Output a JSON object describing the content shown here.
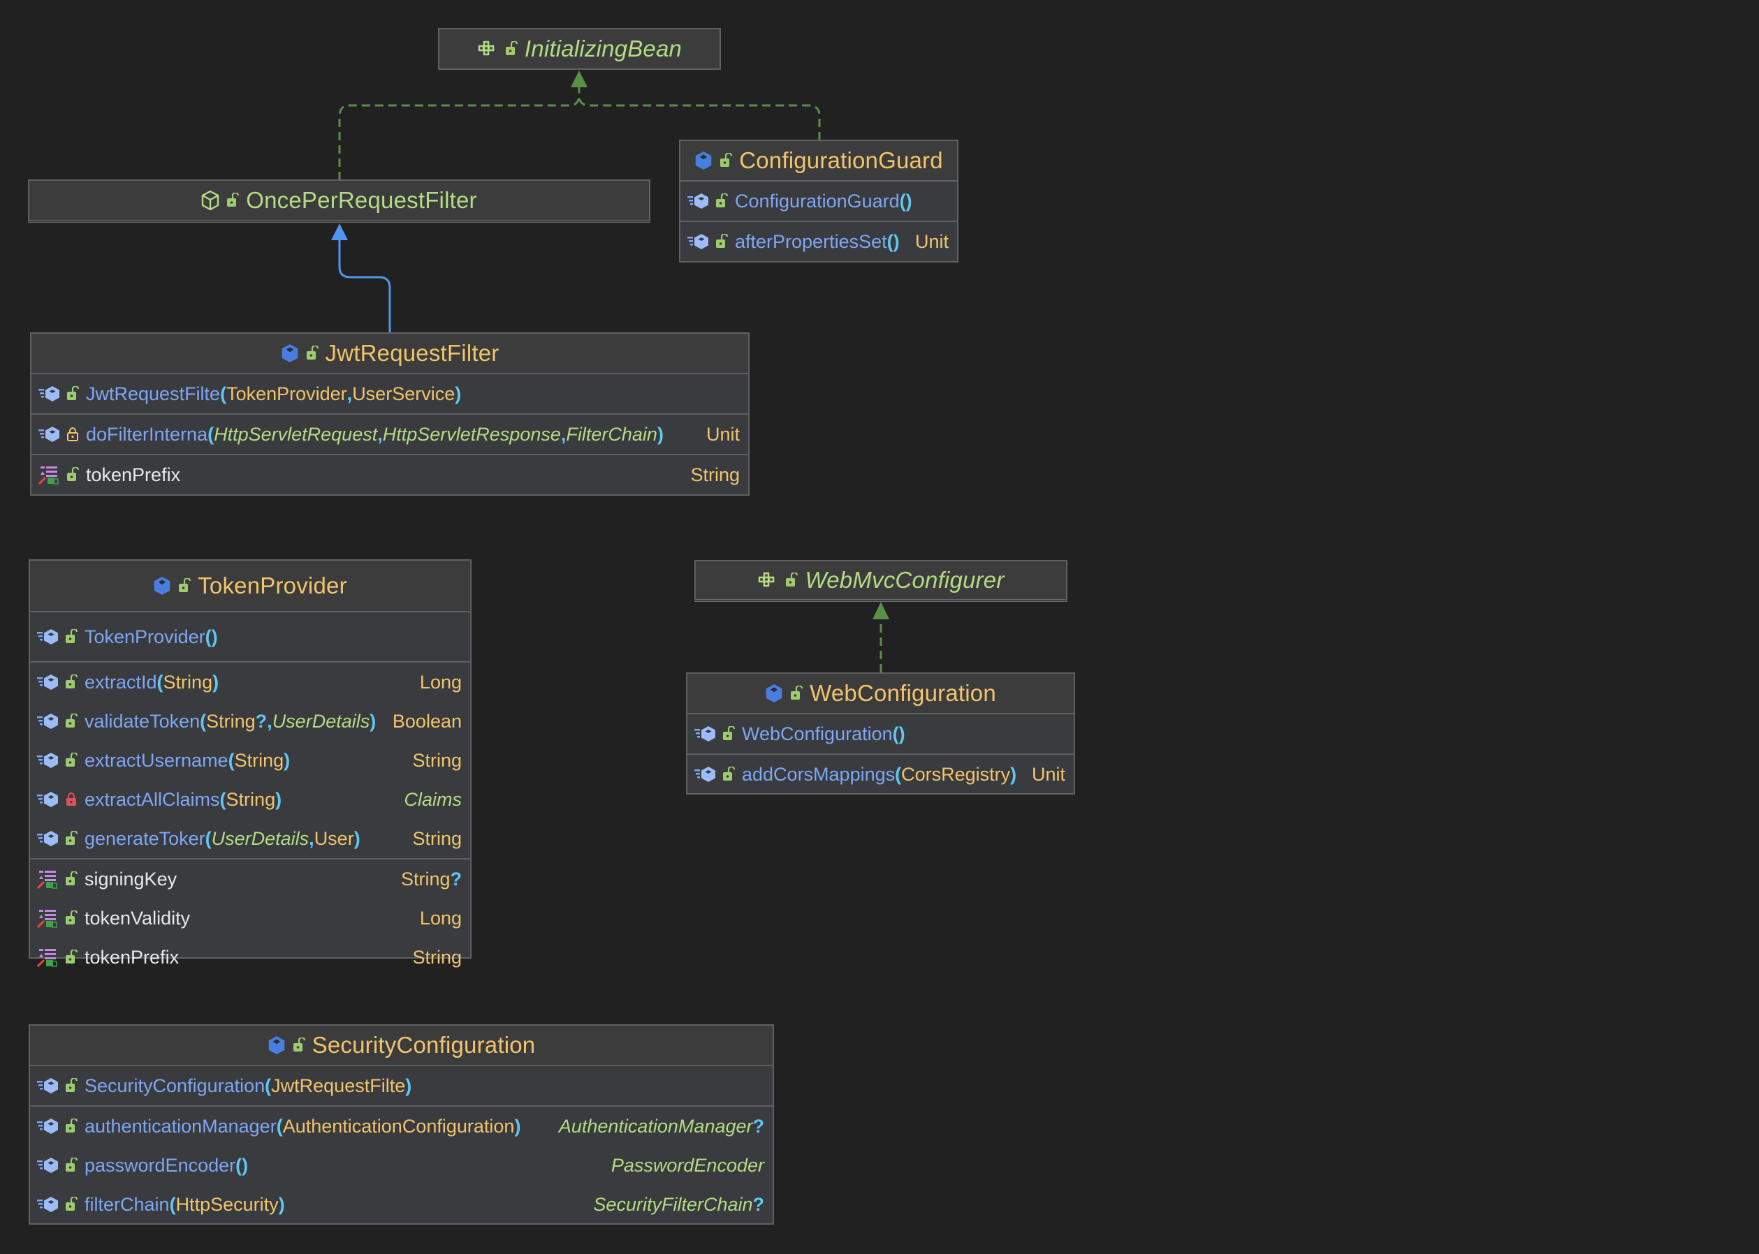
{
  "diagram": {
    "nodes": [
      {
        "id": "InitializingBean",
        "kind": "interface",
        "title": "InitializingBean",
        "members": []
      },
      {
        "id": "OncePerRequestFilter",
        "kind": "abstract-library-class",
        "title": "OncePerRequestFilter",
        "members": []
      },
      {
        "id": "ConfigurationGuard",
        "kind": "class",
        "title": "ConfigurationGuard",
        "constructors": [
          {
            "name": "ConfigurationGuard",
            "params": [],
            "visibility": "public"
          }
        ],
        "methods": [
          {
            "name": "afterPropertiesSet",
            "params": [],
            "returns": "Unit",
            "visibility": "public"
          }
        ]
      },
      {
        "id": "JwtRequestFilter",
        "kind": "class",
        "title": "JwtRequestFilter",
        "constructors": [
          {
            "name": "JwtRequestFilte",
            "params": [
              {
                "t": "TokenProvider"
              },
              {
                "t": "UserService"
              }
            ],
            "visibility": "public"
          }
        ],
        "methods": [
          {
            "name": "doFilterInterna",
            "params": [
              {
                "t": "HttpServletRequest",
                "platform": true
              },
              {
                "t": "HttpServletResponse",
                "platform": true
              },
              {
                "t": "FilterChain",
                "platform": true
              }
            ],
            "returns": "Unit",
            "visibility": "protected"
          }
        ],
        "fields": [
          {
            "name": "tokenPrefix",
            "type": "String",
            "visibility": "public"
          }
        ]
      },
      {
        "id": "TokenProvider",
        "kind": "class",
        "title": "TokenProvider",
        "constructors": [
          {
            "name": "TokenProvider",
            "params": [],
            "visibility": "public"
          }
        ],
        "methods": [
          {
            "name": "extractId",
            "params": [
              {
                "t": "String"
              }
            ],
            "returns": "Long",
            "visibility": "public"
          },
          {
            "name": "validateToken",
            "params": [
              {
                "t": "String",
                "nullable": true
              },
              {
                "t": "UserDetails",
                "platform": true
              }
            ],
            "returns": "Boolean",
            "visibility": "public"
          },
          {
            "name": "extractUsername",
            "params": [
              {
                "t": "String"
              }
            ],
            "returns": "String",
            "visibility": "public"
          },
          {
            "name": "extractAllClaims",
            "params": [
              {
                "t": "String"
              }
            ],
            "returns": "Claims",
            "returns_platform": true,
            "visibility": "private"
          },
          {
            "name": "generateToker",
            "params": [
              {
                "t": "UserDetails",
                "platform": true
              },
              {
                "t": "User"
              }
            ],
            "returns": "String",
            "visibility": "public"
          }
        ],
        "fields": [
          {
            "name": "signingKey",
            "type": "String",
            "nullable": true,
            "visibility": "public"
          },
          {
            "name": "tokenValidity",
            "type": "Long",
            "visibility": "public"
          },
          {
            "name": "tokenPrefix",
            "type": "String",
            "visibility": "public"
          }
        ]
      },
      {
        "id": "WebMvcConfigurer",
        "kind": "interface",
        "title": "WebMvcConfigurer",
        "members": []
      },
      {
        "id": "WebConfiguration",
        "kind": "class",
        "title": "WebConfiguration",
        "constructors": [
          {
            "name": "WebConfiguration",
            "params": [],
            "visibility": "public"
          }
        ],
        "methods": [
          {
            "name": "addCorsMappings",
            "params": [
              {
                "t": "CorsRegistry"
              }
            ],
            "returns": "Unit",
            "visibility": "public"
          }
        ]
      },
      {
        "id": "SecurityConfiguration",
        "kind": "class",
        "title": "SecurityConfiguration",
        "constructors": [
          {
            "name": "SecurityConfiguration",
            "params": [
              {
                "t": "JwtRequestFilte"
              }
            ],
            "visibility": "public"
          }
        ],
        "methods": [
          {
            "name": "authenticationManager",
            "params": [
              {
                "t": "AuthenticationConfiguration"
              }
            ],
            "returns": "AuthenticationManager",
            "returns_platform": true,
            "returns_nullable": true,
            "visibility": "public"
          },
          {
            "name": "passwordEncoder",
            "params": [],
            "returns": "PasswordEncoder",
            "returns_platform": true,
            "visibility": "public"
          },
          {
            "name": "filterChain",
            "params": [
              {
                "t": "HttpSecurity"
              }
            ],
            "returns": "SecurityFilterChain",
            "returns_platform": true,
            "returns_nullable": true,
            "visibility": "public"
          }
        ]
      }
    ],
    "edges": [
      {
        "from": "OncePerRequestFilter",
        "to": "InitializingBean",
        "type": "implements"
      },
      {
        "from": "ConfigurationGuard",
        "to": "InitializingBean",
        "type": "implements"
      },
      {
        "from": "JwtRequestFilter",
        "to": "OncePerRequestFilter",
        "type": "extends"
      },
      {
        "from": "WebConfiguration",
        "to": "WebMvcConfigurer",
        "type": "implements"
      }
    ],
    "colors": {
      "background": "#212121",
      "class_title": "#f2c46b",
      "interface_title": "#b4dc82",
      "method_name": "#7ea6f3",
      "field_name": "#e8e8e8",
      "paren": "#5fc8f2",
      "implements_edge": "#5a8f47",
      "extends_edge": "#4f96f0"
    }
  }
}
